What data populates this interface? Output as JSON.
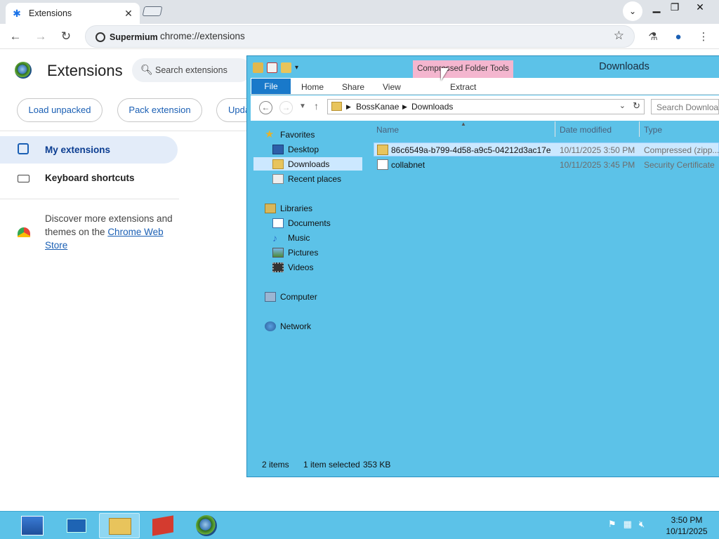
{
  "browser": {
    "tab_title": "Extensions",
    "profile_chip": "Supermium",
    "url": "chrome://extensions"
  },
  "extensions_page": {
    "title": "Extensions",
    "search_placeholder": "Search extensions",
    "buttons": [
      "Load unpacked",
      "Pack extension",
      "Upda"
    ],
    "nav": {
      "my_extensions": "My extensions",
      "keyboard_shortcuts": "Keyboard shortcuts"
    },
    "discover_text": "Discover more extensions and themes on the ",
    "discover_link": "Chrome Web Store"
  },
  "explorer": {
    "context_tab": "Compressed Folder Tools",
    "title": "Downloads",
    "ribbon_tabs": {
      "file": "File",
      "home": "Home",
      "share": "Share",
      "view": "View",
      "extract": "Extract"
    },
    "breadcrumb": [
      "BossKanae",
      "Downloads"
    ],
    "search_placeholder": "Search Downloads",
    "nav": {
      "favorites": "Favorites",
      "desktop": "Desktop",
      "downloads": "Downloads",
      "recent": "Recent places",
      "libraries": "Libraries",
      "documents": "Documents",
      "music": "Music",
      "pictures": "Pictures",
      "videos": "Videos",
      "computer": "Computer",
      "network": "Network"
    },
    "columns": {
      "name": "Name",
      "date": "Date modified",
      "type": "Type"
    },
    "files": [
      {
        "name": "86c6549a-b799-4d58-a9c5-04212d3ac17e",
        "date": "10/11/2025 3:50 PM",
        "type": "Compressed (zipp..."
      },
      {
        "name": "collabnet",
        "date": "10/11/2025 3:45 PM",
        "type": "Security Certificate"
      }
    ],
    "status": {
      "items": "2 items",
      "selected": "1 item selected",
      "size": "353 KB"
    }
  },
  "taskbar": {
    "time": "3:50 PM",
    "date": "10/11/2025"
  },
  "colors": {
    "accent": "#1a5fb4",
    "explorer_frame": "#5cc2e8",
    "file_tab": "#1979ca",
    "context_tab": "#f4b6cf"
  }
}
